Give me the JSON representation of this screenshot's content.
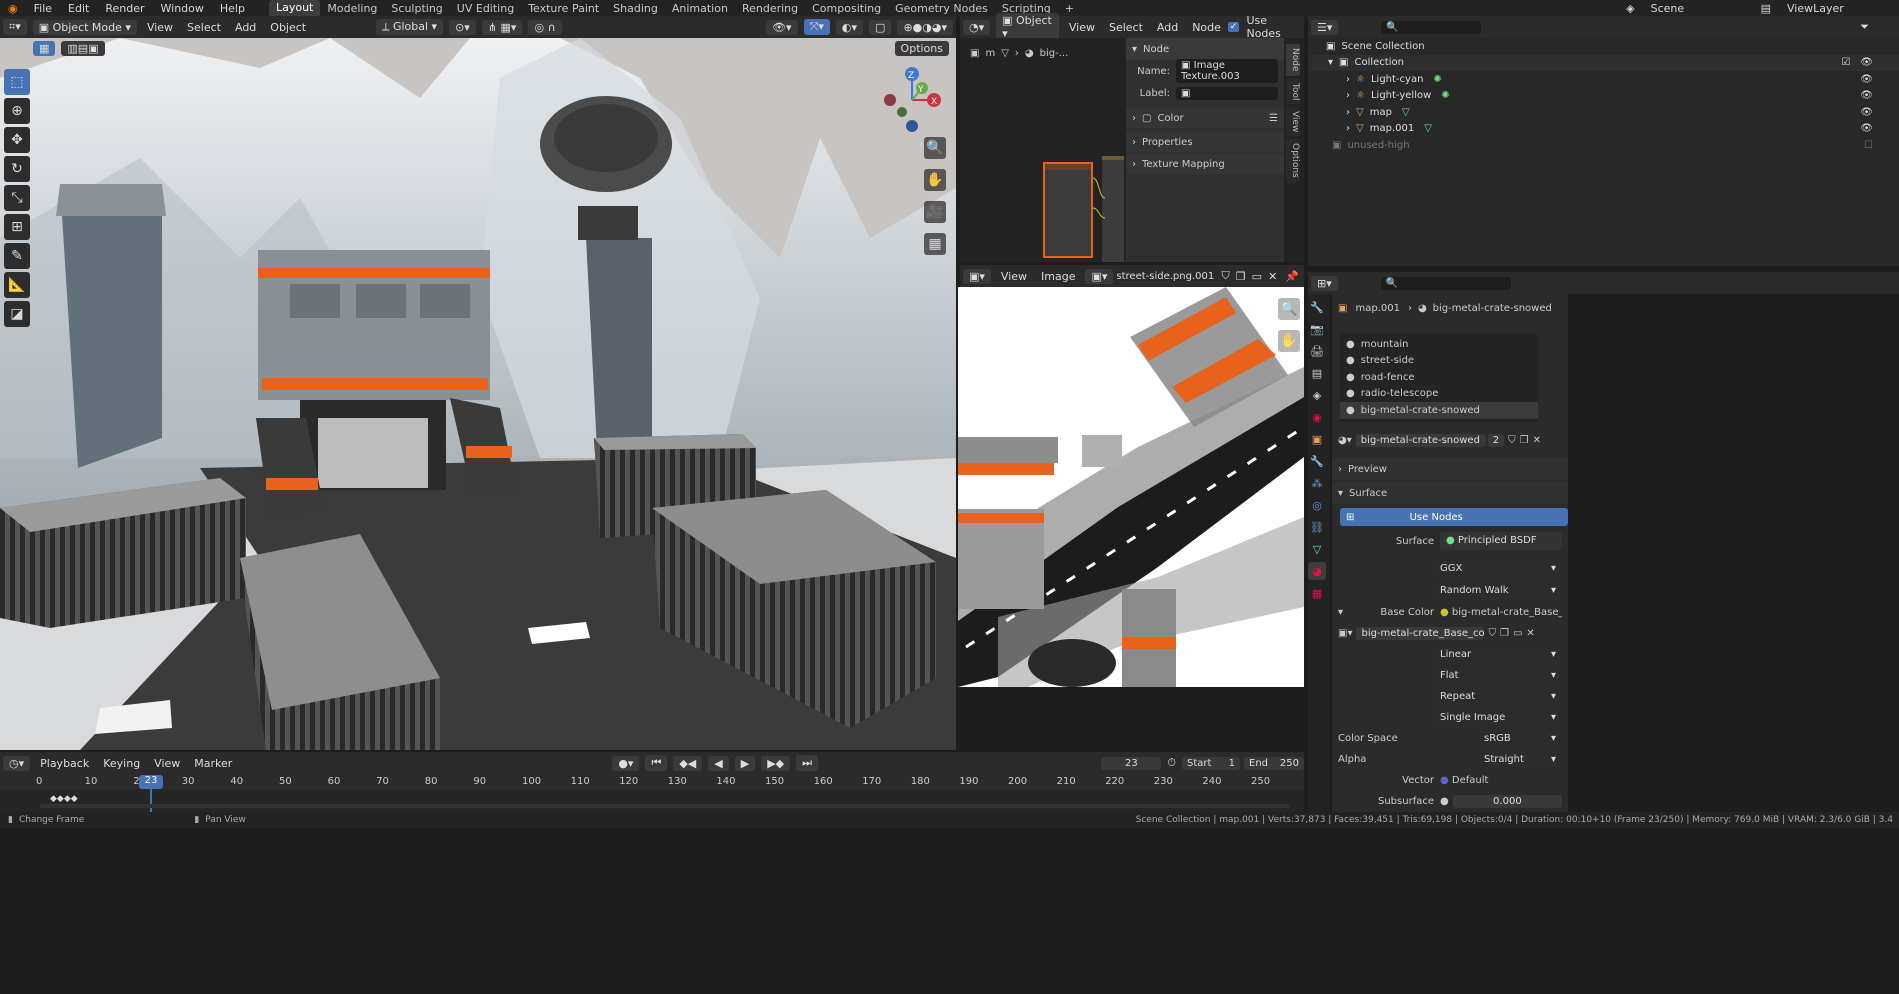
{
  "menubar": {
    "menus": [
      "File",
      "Edit",
      "Render",
      "Window",
      "Help"
    ],
    "workspaces": [
      "Layout",
      "Modeling",
      "Sculpting",
      "UV Editing",
      "Texture Paint",
      "Shading",
      "Animation",
      "Rendering",
      "Compositing",
      "Geometry Nodes",
      "Scripting"
    ],
    "active_workspace": "Layout",
    "scene": "Scene",
    "view_layer": "ViewLayer"
  },
  "viewport": {
    "mode": "Object Mode",
    "menus": [
      "View",
      "Select",
      "Add",
      "Object"
    ],
    "orientation": "Global",
    "options": "Options",
    "gizmo_axes": {
      "z": "Z",
      "y": "Y",
      "x": "X"
    }
  },
  "node_editor": {
    "object": "Object",
    "menus": [
      "View",
      "Select",
      "Add",
      "Node"
    ],
    "use_nodes": "Use Nodes",
    "breadcrumb_m": "m",
    "breadcrumb_mat": "big-...",
    "panel": {
      "title": "Node",
      "name_label": "Name:",
      "name_value": "Image Texture.003",
      "label_label": "Label:",
      "color": "Color",
      "properties": "Properties",
      "texture_mapping": "Texture Mapping"
    },
    "tabs": [
      "Node",
      "Tool",
      "View",
      "Options"
    ]
  },
  "image_editor": {
    "menus": [
      "View",
      "Image"
    ],
    "image_name": "street-side.png.001"
  },
  "outliner": {
    "root": "Scene Collection",
    "collection": "Collection",
    "items": [
      {
        "name": "Light-cyan"
      },
      {
        "name": "Light-yellow"
      },
      {
        "name": "map"
      },
      {
        "name": "map.001"
      }
    ],
    "excluded": "unused-high"
  },
  "properties": {
    "breadcrumb_object": "map.001",
    "breadcrumb_material": "big-metal-crate-snowed",
    "material_slots": [
      "mountain",
      "street-side",
      "road-fence",
      "radio-telescope",
      "big-metal-crate-snowed"
    ],
    "material_name": "big-metal-crate-snowed",
    "user_count": "2",
    "preview": "Preview",
    "surface_section": "Surface",
    "use_nodes": "Use Nodes",
    "surface_label": "Surface",
    "surface_value": "Principled BSDF",
    "distribution": "GGX",
    "subsurface_method": "Random Walk",
    "base_color_label": "Base Color",
    "base_color_value": "big-metal-crate_Base_...",
    "image_name": "big-metal-crate_Base_color...",
    "interpolation": "Linear",
    "projection": "Flat",
    "extension": "Repeat",
    "source": "Single Image",
    "color_space_label": "Color Space",
    "color_space": "sRGB",
    "alpha_label": "Alpha",
    "alpha": "Straight",
    "vector_label": "Vector",
    "vector": "Default",
    "subsurface_label": "Subsurface",
    "subsurface": "0.000"
  },
  "timeline": {
    "menus": [
      "Playback",
      "Keying",
      "View",
      "Marker"
    ],
    "current_frame": "23",
    "start_label": "Start",
    "start": "1",
    "end_label": "End",
    "end": "250",
    "ticks": [
      "0",
      "10",
      "20",
      "30",
      "40",
      "50",
      "60",
      "70",
      "80",
      "90",
      "100",
      "110",
      "120",
      "130",
      "140",
      "150",
      "160",
      "170",
      "180",
      "190",
      "200",
      "210",
      "220",
      "230",
      "240",
      "250"
    ]
  },
  "statusbar": {
    "left": "Change Frame",
    "middle": "Pan View",
    "right": "Scene Collection | map.001 | Verts:37,873 | Faces:39,451 | Tris:69,198 | Objects:0/4 | Duration: 00:10+10 (Frame 23/250) | Memory: 769.0 MiB | VRAM: 2.3/6.0 GiB | 3.4"
  },
  "colors": {
    "accent": "#4772b3",
    "orange": "#e8621b",
    "panel": "#303030",
    "frame_marker": "#4772b3"
  }
}
